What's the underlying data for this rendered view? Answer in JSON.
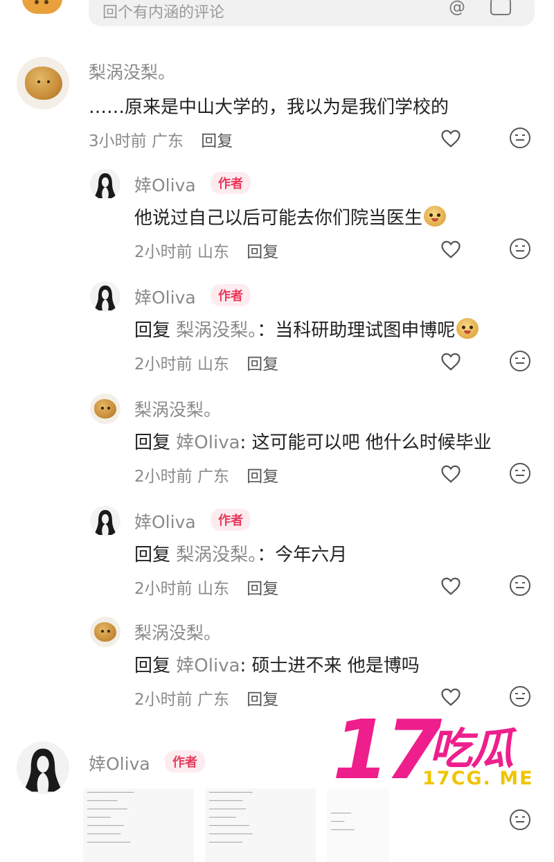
{
  "input": {
    "placeholder": "回个有内涵的评论"
  },
  "comments": [
    {
      "name": "梨涡没梨。",
      "text": "……原来是中山大学的，我以为是我们学校的",
      "time": "3小时前",
      "location": "广东",
      "reply": "回复"
    },
    {
      "name": "婞Oliva",
      "badge": "作者",
      "text": "他说过自己以后可能去你们院当医生",
      "time": "2小时前",
      "location": "山东",
      "reply": "回复"
    },
    {
      "name": "婞Oliva",
      "badge": "作者",
      "prefix": "回复",
      "ref": "梨涡没梨。",
      "text": "：当科研助理试图申博呢",
      "time": "2小时前",
      "location": "山东",
      "reply": "回复"
    },
    {
      "name": "梨涡没梨。",
      "prefix": "回复",
      "ref": "婞Oliva",
      "text": ": 这可能可以吧  他什么时候毕业",
      "time": "2小时前",
      "location": "广东",
      "reply": "回复"
    },
    {
      "name": "婞Oliva",
      "badge": "作者",
      "prefix": "回复",
      "ref": "梨涡没梨。",
      "text": "：今年六月",
      "time": "2小时前",
      "location": "山东",
      "reply": "回复"
    },
    {
      "name": "梨涡没梨。",
      "prefix": "回复",
      "ref": "婞Oliva",
      "text": ": 硕士进不来 他是博吗",
      "time": "2小时前",
      "location": "广东",
      "reply": "回复"
    },
    {
      "name": "婞Oliva",
      "badge": "作者"
    }
  ],
  "watermark": {
    "number": "17",
    "brand": "吃瓜",
    "url": "17CG. ME"
  },
  "icons": [
    "heart-icon",
    "smile-icon",
    "at-icon",
    "image-icon"
  ],
  "colors": {
    "author_badge": "#e8395a",
    "watermark_pink": "#ee1f8c",
    "watermark_yellow": "#f0c400"
  }
}
